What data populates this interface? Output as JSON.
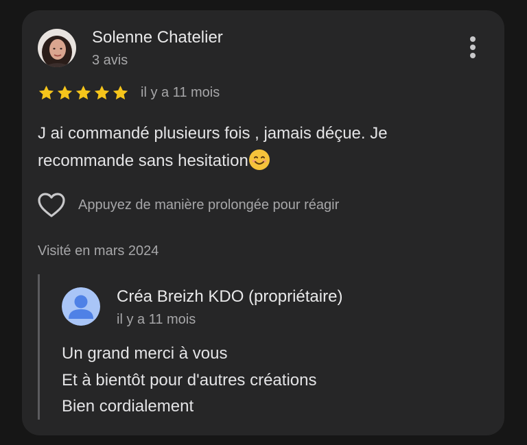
{
  "review": {
    "author": "Solenne Chatelier",
    "author_reviews": "3 avis",
    "rating": 5,
    "max_rating": 5,
    "time": "il y a 11 mois",
    "text": "J ai commandé plusieurs fois , jamais déçue. Je recommande sans hesitation",
    "react_hint": "Appuyez de manière prolongée pour réagir",
    "visited": "Visité en mars 2024"
  },
  "owner_reply": {
    "name": "Créa Breizh KDO (propriétaire)",
    "time": "il y a 11 mois",
    "lines": [
      "Un grand merci à vous",
      "Et à bientôt pour d'autres créations",
      "Bien cordialement"
    ]
  },
  "icons": {
    "menu": "more-vert-icon",
    "star": "star-icon",
    "emoji": "smiling-face-emoji",
    "heart": "heart-outline-icon",
    "owner_avatar": "person-avatar-icon"
  },
  "colors": {
    "background": "#161616",
    "card": "#262627",
    "star": "#f6c51b",
    "owner_avatar_bg": "#a9c5f7",
    "owner_avatar_fg": "#4f81e6"
  }
}
